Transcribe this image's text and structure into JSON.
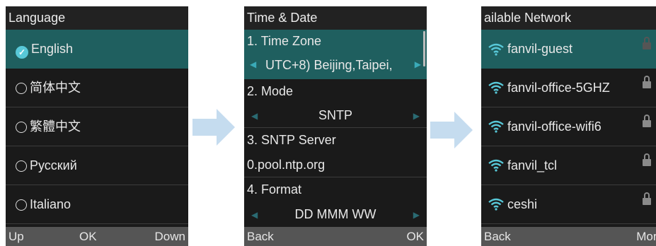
{
  "language_screen": {
    "title": "Language",
    "items": [
      {
        "label": "English",
        "selected": true
      },
      {
        "label": "简体中文",
        "selected": false
      },
      {
        "label": "繁體中文",
        "selected": false
      },
      {
        "label": "Русский",
        "selected": false
      },
      {
        "label": "Italiano",
        "selected": false
      }
    ],
    "softkeys": {
      "left": "Up",
      "center": "OK",
      "right": "Down"
    }
  },
  "time_date_screen": {
    "title": "Time & Date",
    "time_zone_label": "1. Time Zone",
    "time_zone_value": "UTC+8) Beijing,Taipei,",
    "mode_label": "2. Mode",
    "mode_value": "SNTP",
    "sntp_label": "3. SNTP Server",
    "sntp_value": "0.pool.ntp.org",
    "format_label": "4. Format",
    "format_value": "DD MMM WW",
    "softkeys": {
      "left": "Back",
      "right": "OK"
    }
  },
  "network_screen": {
    "title": "ailable Network",
    "networks": [
      {
        "name": "fanvil-guest"
      },
      {
        "name": "fanvil-office-5GHZ"
      },
      {
        "name": "fanvil-office-wifi6"
      },
      {
        "name": "fanvil_tcl"
      },
      {
        "name": "ceshi"
      }
    ],
    "softkeys": {
      "left": "Back",
      "right": "More"
    }
  },
  "colors": {
    "accent": "#1f5f5f",
    "highlight_icon": "#3aaab8",
    "arrow": "#c5dcef"
  },
  "icons": [
    "check-icon",
    "radio-icon",
    "arrow-left-icon",
    "arrow-right-icon",
    "wifi-icon",
    "lock-icon",
    "flow-arrow-icon"
  ]
}
